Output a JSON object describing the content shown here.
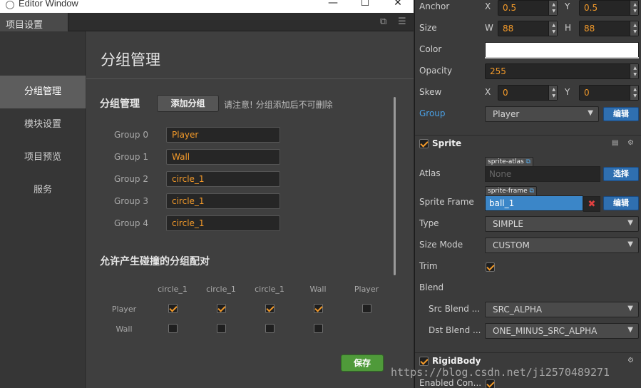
{
  "window": {
    "title": "Editor Window",
    "minimize": "—",
    "maximize": "☐",
    "close": "✕"
  },
  "tab": {
    "label": "项目设置"
  },
  "sidebar": {
    "items": [
      {
        "label": "分组管理"
      },
      {
        "label": "模块设置"
      },
      {
        "label": "项目预览"
      },
      {
        "label": "服务"
      }
    ]
  },
  "main": {
    "title": "分组管理",
    "group_section_label": "分组管理",
    "add_group_label": "添加分组",
    "add_note": "请注意! 分组添加后不可删除",
    "groups": [
      {
        "label": "Group 0",
        "value": "Player"
      },
      {
        "label": "Group 1",
        "value": "Wall"
      },
      {
        "label": "Group 2",
        "value": "circle_1"
      },
      {
        "label": "Group 3",
        "value": "circle_1"
      },
      {
        "label": "Group 4",
        "value": "circle_1"
      }
    ],
    "collision_section_label": "允许产生碰撞的分组配对",
    "matrix": {
      "columns": [
        "circle_1",
        "circle_1",
        "circle_1",
        "Wall",
        "Player"
      ],
      "rows": [
        {
          "label": "Player",
          "checks": [
            true,
            true,
            true,
            true,
            false
          ]
        },
        {
          "label": "Wall",
          "checks": [
            false,
            false,
            false,
            false
          ]
        }
      ]
    },
    "save_label": "保存"
  },
  "inspector": {
    "anchor": {
      "label": "Anchor",
      "x_label": "X",
      "x": "0.5",
      "y_label": "Y",
      "y": "0.5"
    },
    "size": {
      "label": "Size",
      "w_label": "W",
      "w": "88",
      "h_label": "H",
      "h": "88"
    },
    "color": {
      "label": "Color",
      "value": "#ffffff"
    },
    "opacity": {
      "label": "Opacity",
      "value": "255"
    },
    "skew": {
      "label": "Skew",
      "x_label": "X",
      "x": "0",
      "y_label": "Y",
      "y": "0"
    },
    "group": {
      "label": "Group",
      "value": "Player",
      "edit_label": "编辑"
    },
    "sprite": {
      "title": "Sprite",
      "atlas_label": "Atlas",
      "atlas_tag": "sprite-atlas",
      "atlas_value": "None",
      "atlas_btn": "选择",
      "frame_label": "Sprite Frame",
      "frame_tag": "sprite-frame",
      "frame_value": "ball_1",
      "frame_btn": "编辑",
      "type_label": "Type",
      "type_value": "SIMPLE",
      "size_mode_label": "Size Mode",
      "size_mode_value": "CUSTOM",
      "trim_label": "Trim",
      "blend_label": "Blend",
      "src_blend_label": "Src Blend ...",
      "src_blend_value": "SRC_ALPHA",
      "dst_blend_label": "Dst Blend ...",
      "dst_blend_value": "ONE_MINUS_SRC_ALPHA"
    },
    "rigidbody": {
      "title": "RigidBody",
      "enabled_contact_label": "Enabled Con..."
    }
  },
  "watermark": "https://blog.csdn.net/ji2570489271"
}
